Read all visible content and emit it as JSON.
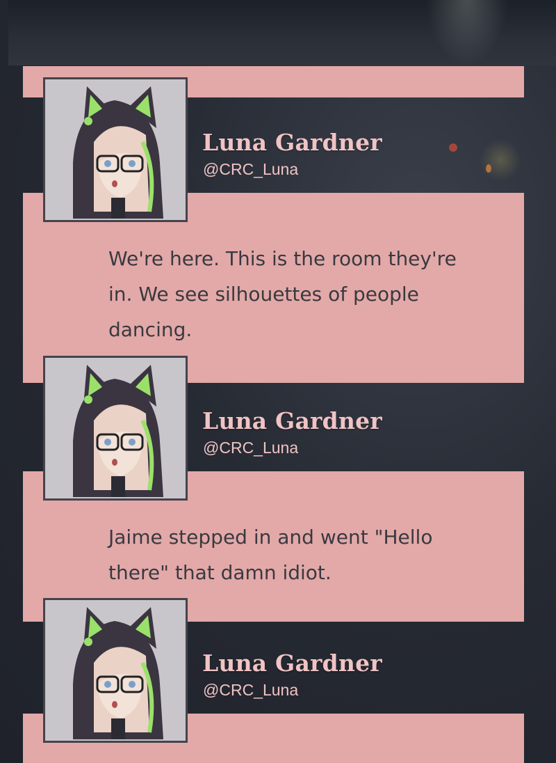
{
  "posts": [
    {
      "name": "Luna Gardner",
      "handle": "@CRC_Luna",
      "message": "We're here. This is the room they're in. We see silhouettes of people dancing."
    },
    {
      "name": "Luna Gardner",
      "handle": "@CRC_Luna",
      "message": "Jaime stepped in and went \"Hello there\" that damn idiot."
    },
    {
      "name": "Luna Gardner",
      "handle": "@CRC_Luna",
      "message": ""
    }
  ],
  "colors": {
    "panel": "#e2a9a8",
    "name": "#f0c3c4",
    "text": "#3a3940",
    "avatar_border": "#45434c",
    "background": "#262a33"
  },
  "icons": {
    "avatar": "cat-hood-girl-avatar"
  }
}
